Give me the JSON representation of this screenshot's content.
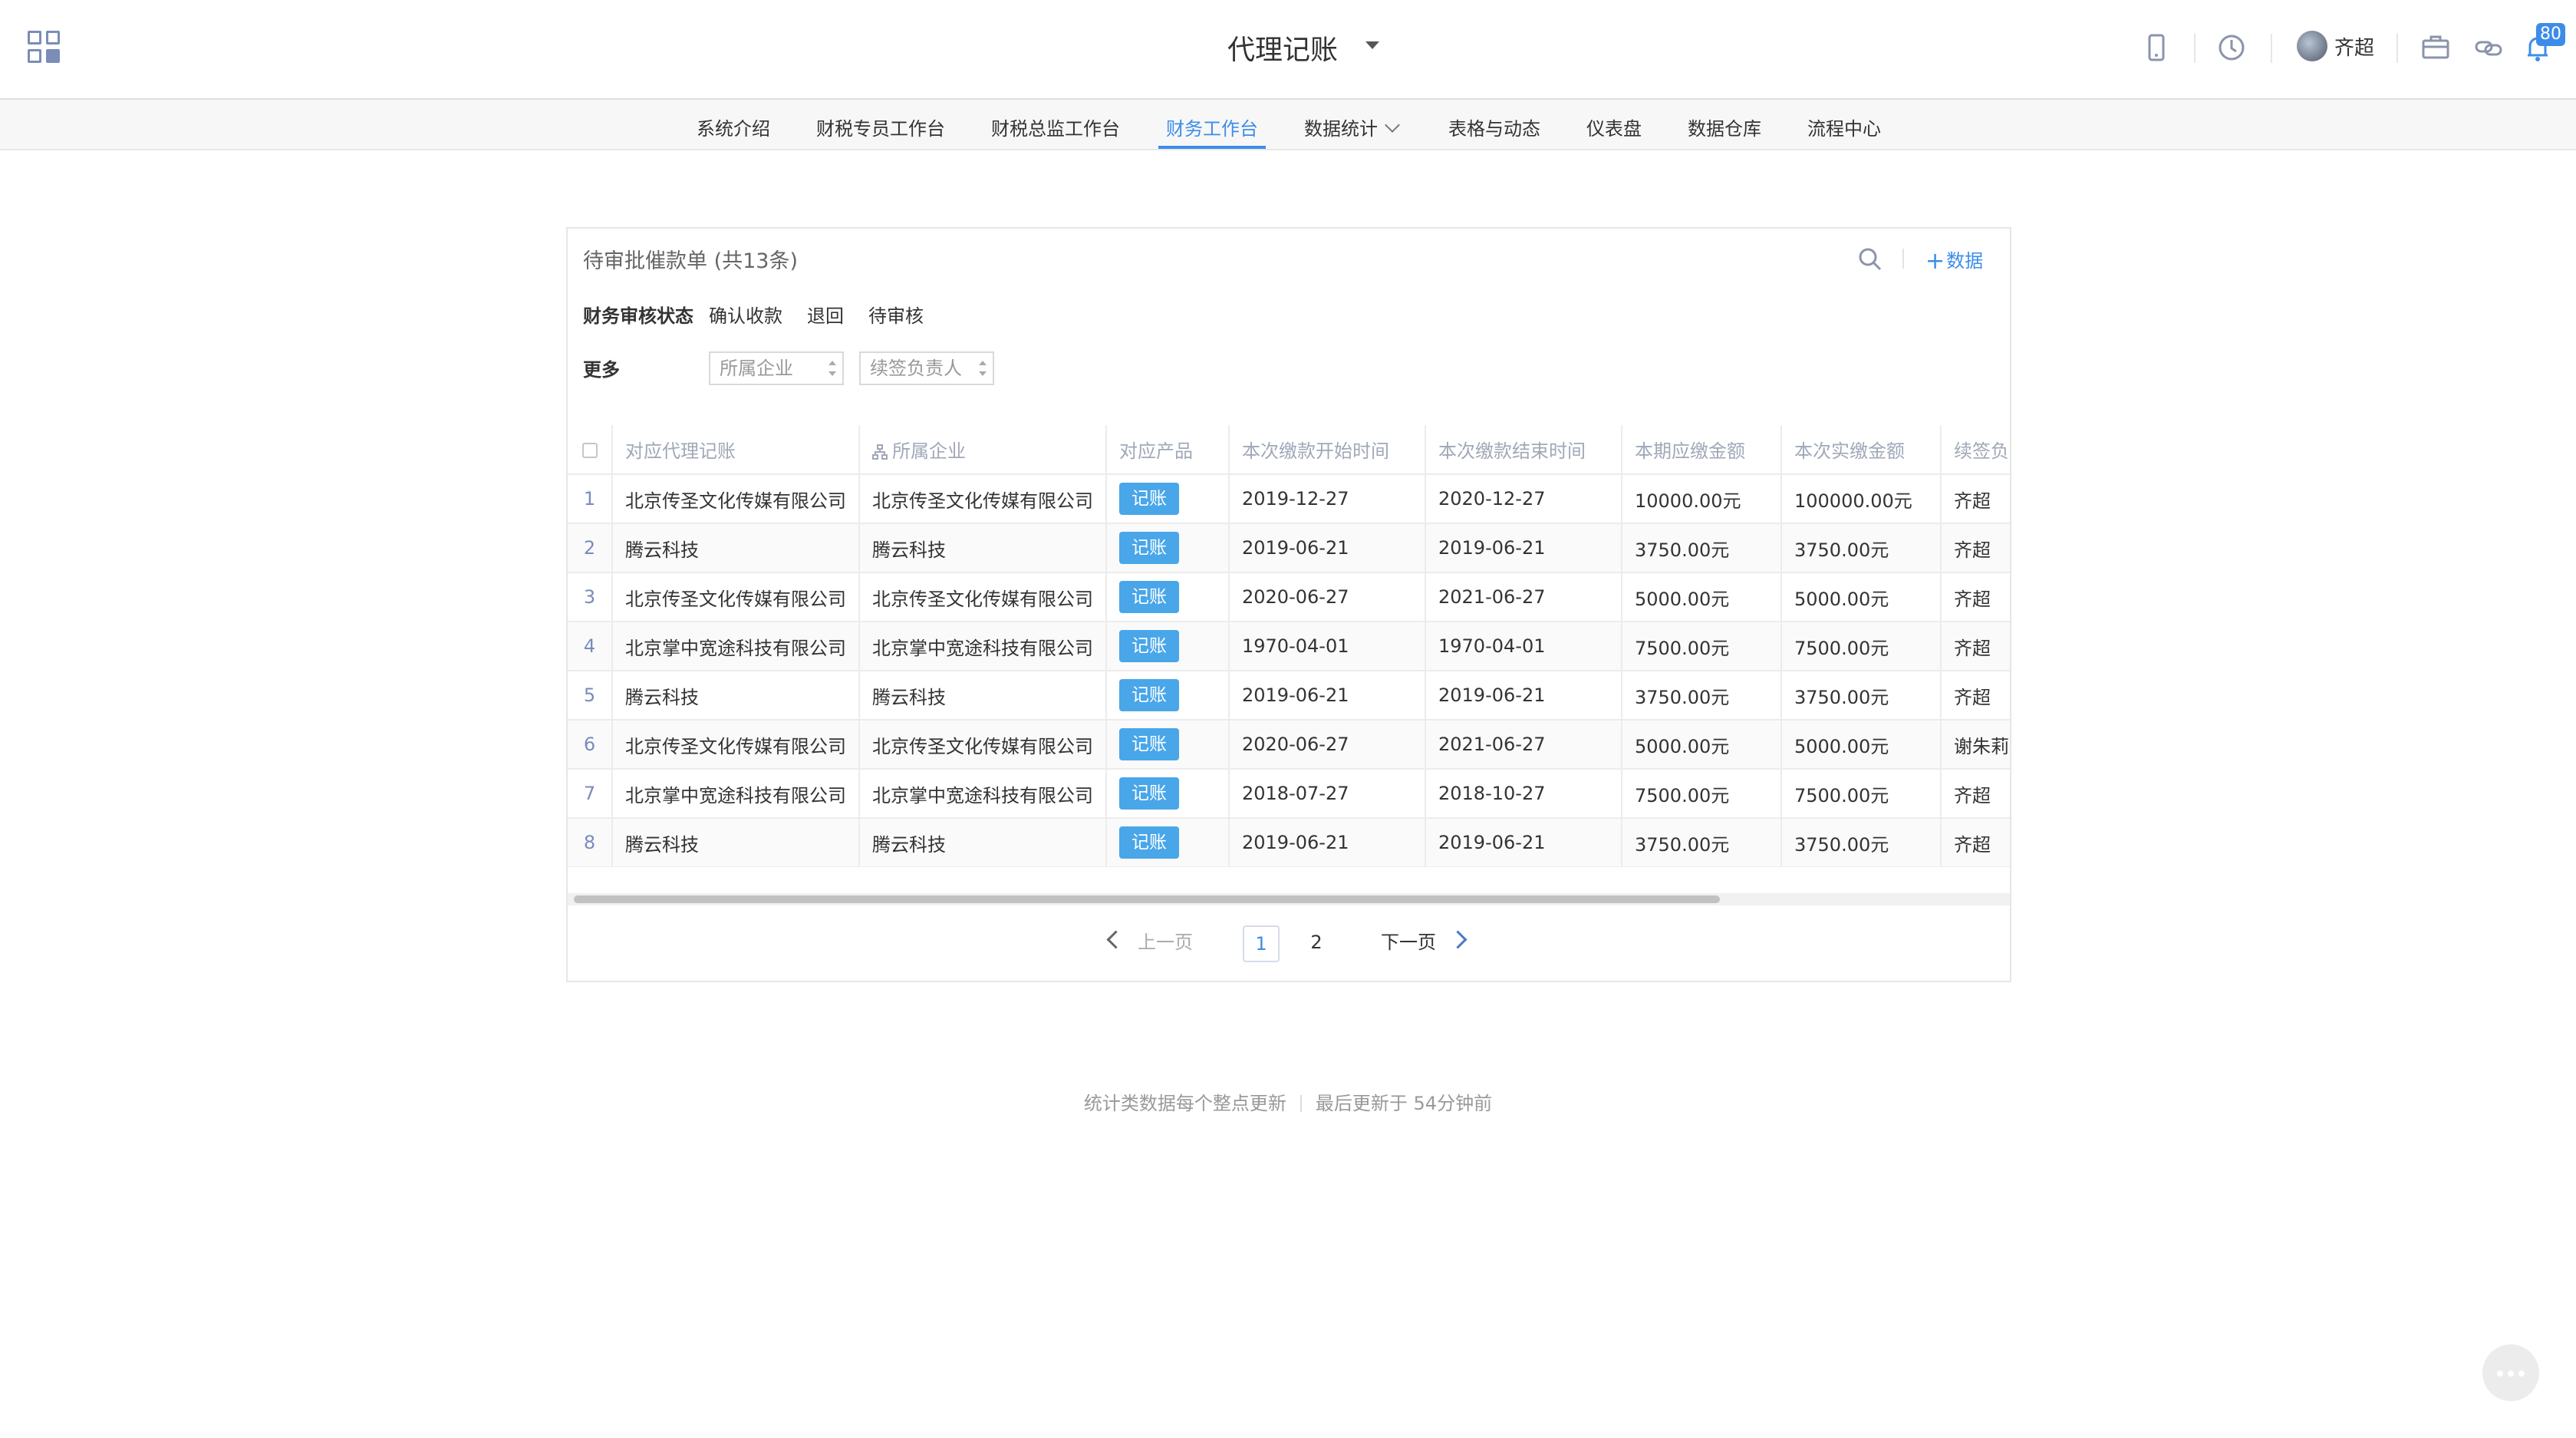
{
  "header": {
    "app_title": "代理记账",
    "user_name": "齐超",
    "notification_count": "80",
    "icons": [
      "apps-grid-icon",
      "phone-icon",
      "clock-icon",
      "briefcase-icon",
      "link-icon",
      "bell-icon"
    ]
  },
  "nav": {
    "items": [
      "系统介绍",
      "财税专员工作台",
      "财税总监工作台",
      "财务工作台",
      "数据统计",
      "表格与动态",
      "仪表盘",
      "数据仓库",
      "流程中心"
    ],
    "active": "财务工作台"
  },
  "panel": {
    "title": "待审批催款单 (共13条)",
    "add_label": "数据",
    "filters": {
      "status_label": "财务审核状态",
      "status_options": [
        "确认收款",
        "退回",
        "待审核"
      ],
      "more_label": "更多",
      "select_company_placeholder": "所属企业",
      "select_owner_placeholder": "续签负责人"
    }
  },
  "table": {
    "columns": [
      "对应代理记账",
      "所属企业",
      "对应产品",
      "本次缴款开始时间",
      "本次缴款结束时间",
      "本期应缴金额",
      "本次实缴金额",
      "续签负责人"
    ],
    "rows": [
      {
        "idx": "1",
        "agency": "北京传圣文化传媒有限公司",
        "company": "北京传圣文化传媒有限公司",
        "product": "记账",
        "start": "2019-12-27",
        "end": "2020-12-27",
        "due": "10000.00元",
        "paid": "100000.00元",
        "owner": "齐超"
      },
      {
        "idx": "2",
        "agency": "腾云科技",
        "company": "腾云科技",
        "product": "记账",
        "start": "2019-06-21",
        "end": "2019-06-21",
        "due": "3750.00元",
        "paid": "3750.00元",
        "owner": "齐超"
      },
      {
        "idx": "3",
        "agency": "北京传圣文化传媒有限公司",
        "company": "北京传圣文化传媒有限公司",
        "product": "记账",
        "start": "2020-06-27",
        "end": "2021-06-27",
        "due": "5000.00元",
        "paid": "5000.00元",
        "owner": "齐超"
      },
      {
        "idx": "4",
        "agency": "北京掌中宽途科技有限公司",
        "company": "北京掌中宽途科技有限公司",
        "product": "记账",
        "start": "1970-04-01",
        "end": "1970-04-01",
        "due": "7500.00元",
        "paid": "7500.00元",
        "owner": "齐超"
      },
      {
        "idx": "5",
        "agency": "腾云科技",
        "company": "腾云科技",
        "product": "记账",
        "start": "2019-06-21",
        "end": "2019-06-21",
        "due": "3750.00元",
        "paid": "3750.00元",
        "owner": "齐超"
      },
      {
        "idx": "6",
        "agency": "北京传圣文化传媒有限公司",
        "company": "北京传圣文化传媒有限公司",
        "product": "记账",
        "start": "2020-06-27",
        "end": "2021-06-27",
        "due": "5000.00元",
        "paid": "5000.00元",
        "owner": "谢朱莉"
      },
      {
        "idx": "7",
        "agency": "北京掌中宽途科技有限公司",
        "company": "北京掌中宽途科技有限公司",
        "product": "记账",
        "start": "2018-07-27",
        "end": "2018-10-27",
        "due": "7500.00元",
        "paid": "7500.00元",
        "owner": "齐超"
      },
      {
        "idx": "8",
        "agency": "腾云科技",
        "company": "腾云科技",
        "product": "记账",
        "start": "2019-06-21",
        "end": "2019-06-21",
        "due": "3750.00元",
        "paid": "3750.00元",
        "owner": "齐超"
      }
    ]
  },
  "pagination": {
    "prev_label": "上一页",
    "next_label": "下一页",
    "pages": [
      "1",
      "2"
    ],
    "current": "1"
  },
  "footer": {
    "left": "统计类数据每个整点更新",
    "right": "最后更新于 54分钟前"
  },
  "colors": {
    "accent": "#3d8de8",
    "tag": "#49a6e9"
  }
}
